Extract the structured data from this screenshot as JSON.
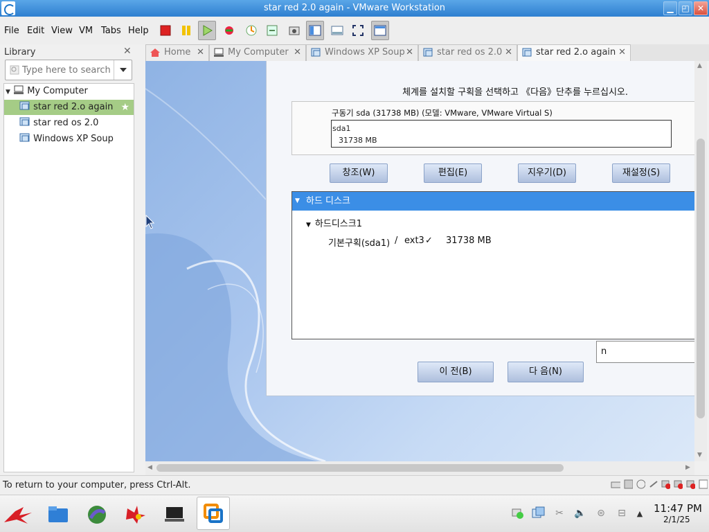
{
  "window": {
    "title": "star red 2.0 again - VMware Workstation",
    "minimize": "▁",
    "maximize": "◰",
    "close": "✕"
  },
  "menubar": {
    "items": [
      "File",
      "Edit",
      "View",
      "VM",
      "Tabs",
      "Help"
    ]
  },
  "library": {
    "title": "Library",
    "search_placeholder": "Type here to search",
    "root": "My Computer",
    "items": [
      "star red 2.o again",
      "star red os 2.0",
      "Windows XP Soup"
    ]
  },
  "tabs": [
    {
      "label": "Home"
    },
    {
      "label": "My Computer"
    },
    {
      "label": "Windows XP Soup"
    },
    {
      "label": "star red os 2.0"
    },
    {
      "label": "star red 2.o again"
    }
  ],
  "installer": {
    "instruction": "체계를 설치할 구획을 선택하고 《다음》단추를 누르십시오.",
    "drive_label": "구동기  sda (31738 MB) (모델: VMware, VMware Virtual S)",
    "partition_name": "sda1",
    "partition_size": "31738 MB",
    "buttons": [
      "창조(W)",
      "편집(E)",
      "지우기(D)",
      "재설정(S)"
    ],
    "tree_root": "하드 디스크",
    "disk_node": "하드디스크1",
    "row_name": "기본구획(sda1)",
    "row_sep": "/",
    "row_fs": "ext3",
    "row_check": "✓",
    "row_size": "31738 MB",
    "input_value": "n",
    "back": "이 전(B)",
    "next": "다 음(N)"
  },
  "status": {
    "text": "To return to your computer, press Ctrl-Alt."
  },
  "clock": {
    "time": "11:47 PM",
    "date": "2/1/25"
  }
}
